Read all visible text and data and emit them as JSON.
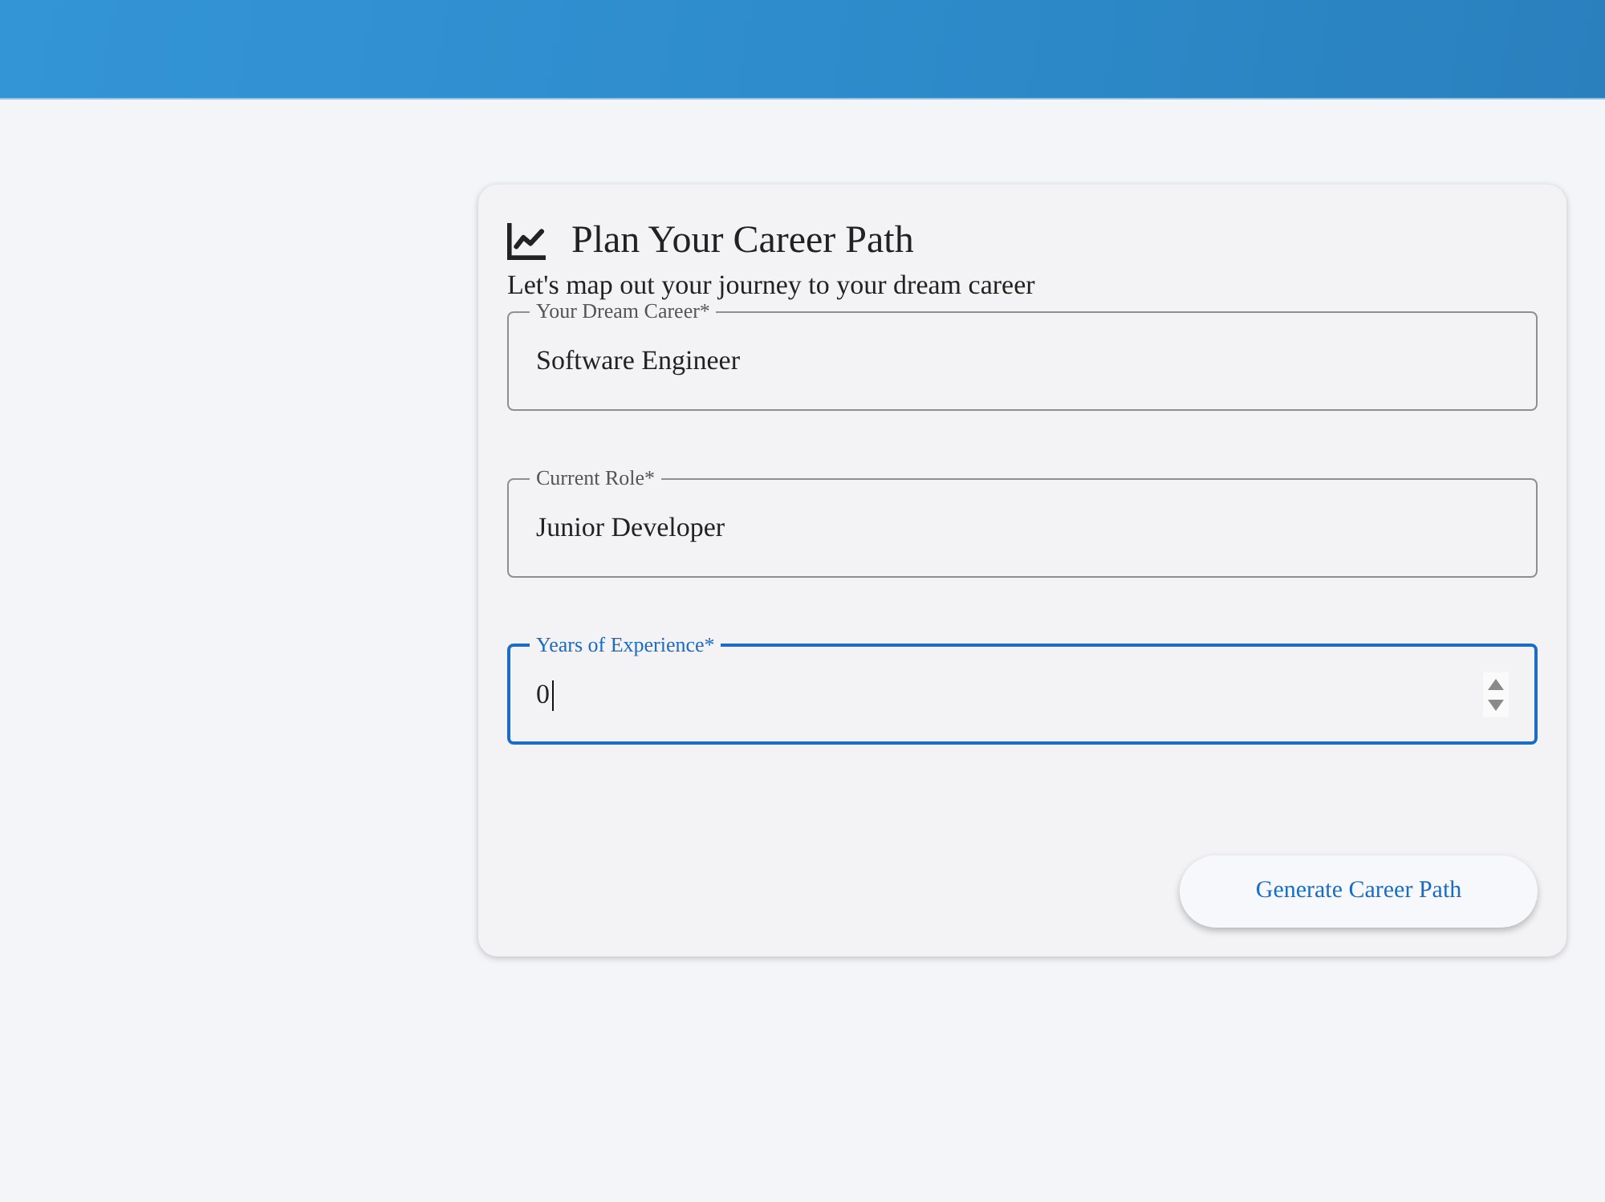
{
  "card": {
    "title": "Plan Your Career Path",
    "subtitle": "Let's map out your journey to your dream career"
  },
  "fields": [
    {
      "kind": "text",
      "label": "Your Dream Career*",
      "value": "Software Engineer",
      "focused": false
    },
    {
      "kind": "text",
      "label": "Current Role*",
      "value": "Junior Developer",
      "focused": false
    },
    {
      "kind": "number",
      "label": "Years of Experience*",
      "value": "0",
      "focused": true
    }
  ],
  "submit_button": {
    "label": "Generate Career Path"
  }
}
